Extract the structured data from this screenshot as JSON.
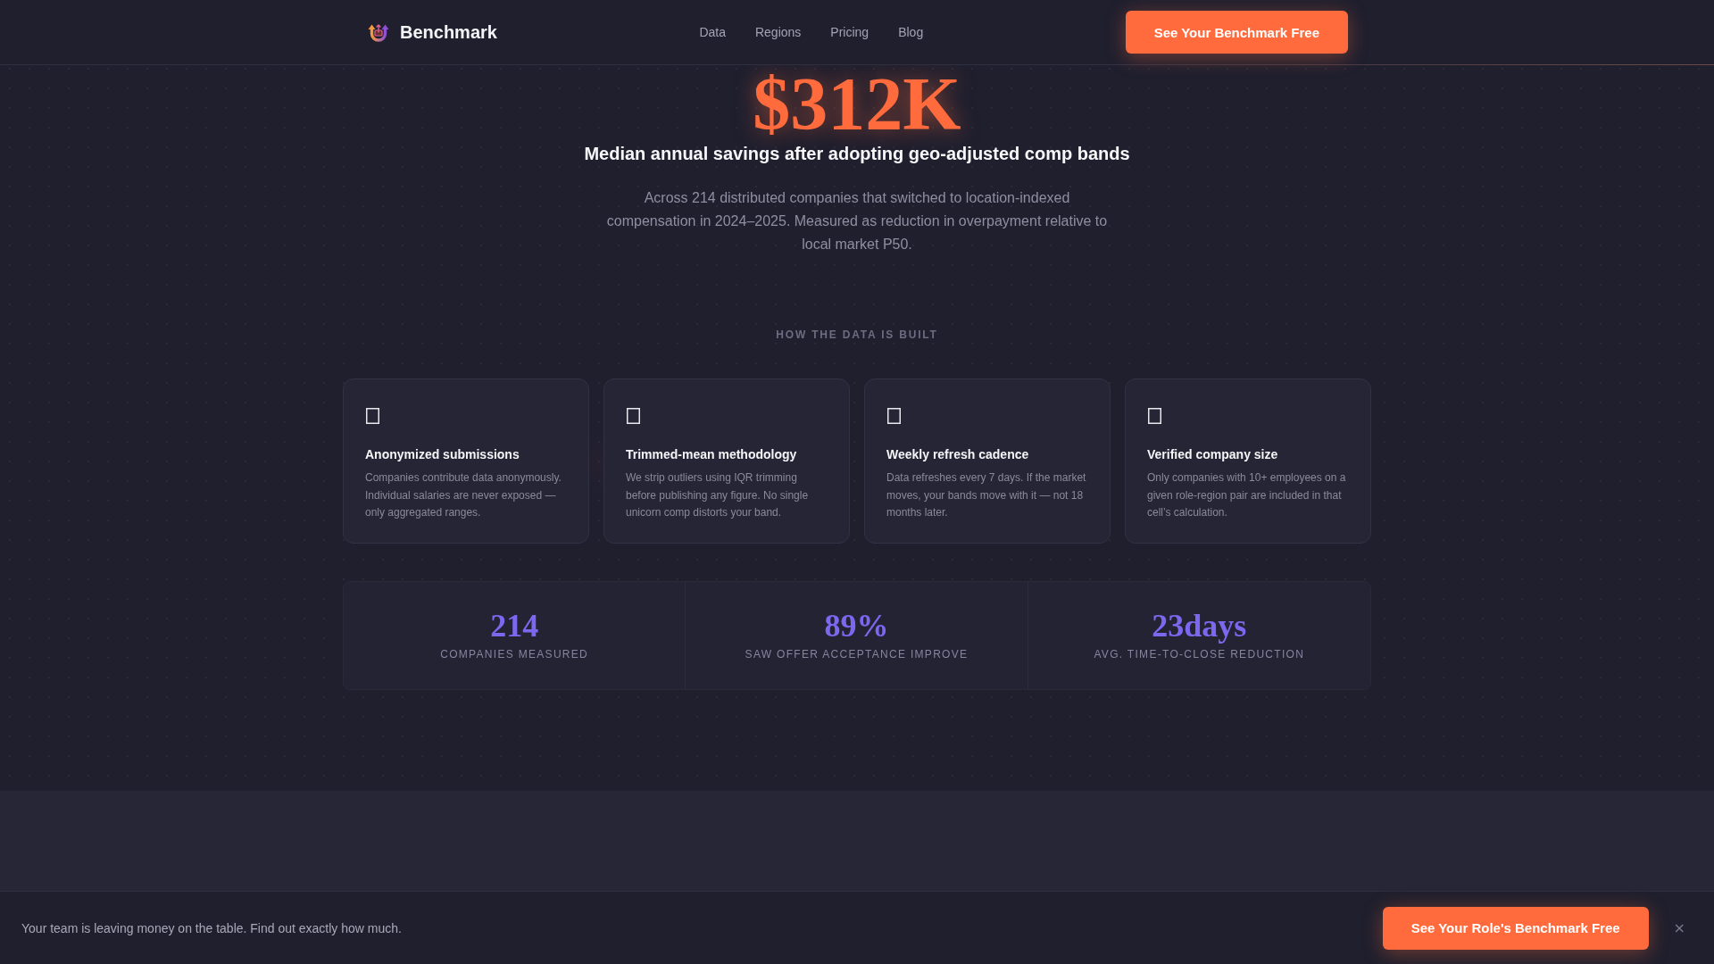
{
  "header": {
    "brand": "Benchmark",
    "nav": [
      "Data",
      "Regions",
      "Pricing",
      "Blog"
    ],
    "cta": "See Your Benchmark Free"
  },
  "hero": {
    "figure": "$312K",
    "headline": "Median annual savings after adopting geo-adjusted comp bands",
    "description": "Across 214 distributed companies that switched to location-indexed compensation in 2024–2025. Measured as reduction in overpayment relative to local market P50."
  },
  "methodology": {
    "eyebrow": "HOW THE DATA IS BUILT",
    "cards": [
      {
        "title": "Anonymized submissions",
        "description": "Companies contribute data anonymously. Individual salaries are never exposed — only aggregated ranges."
      },
      {
        "title": "Trimmed-mean methodology",
        "description": "We strip outliers using IQR trimming before publishing any figure. No single unicorn comp distorts your band."
      },
      {
        "title": "Weekly refresh cadence",
        "description": "Data refreshes every 7 days. If the market moves, your bands move with it — not 18 months later."
      },
      {
        "title": "Verified company size",
        "description": "Only companies with 10+ employees on a given role-region pair are included in that cell’s calculation."
      }
    ]
  },
  "stats": [
    {
      "value": "214",
      "label": "COMPANIES MEASURED"
    },
    {
      "value": "89%",
      "label": "SAW OFFER ACCEPTANCE IMPROVE"
    },
    {
      "value": "23days",
      "label": "AVG. TIME-TO-CLOSE REDUCTION"
    }
  ],
  "sticky_bar": {
    "message": "Your team is leaving money on the table. Find out exactly how much.",
    "cta": "See Your Role's Benchmark Free",
    "close": "×"
  }
}
